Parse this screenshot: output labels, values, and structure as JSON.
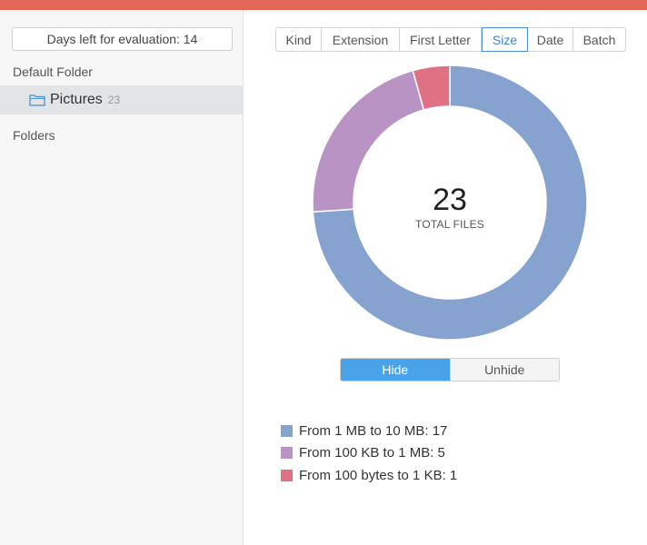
{
  "sidebar": {
    "evaluation_button": "Days left for evaluation: 14",
    "default_folder_title": "Default Folder",
    "selected_folder": {
      "label": "Pictures",
      "count": "23",
      "icon": "folder-icon"
    },
    "folders_title": "Folders"
  },
  "tabs": [
    {
      "label": "Kind",
      "active": false
    },
    {
      "label": "Extension",
      "active": false
    },
    {
      "label": "First Letter",
      "active": false
    },
    {
      "label": "Size",
      "active": true
    },
    {
      "label": "Date",
      "active": false
    },
    {
      "label": "Batch",
      "active": false
    }
  ],
  "chart": {
    "total": "23",
    "total_label": "TOTAL FILES",
    "segments": [
      {
        "label": "From 1 MB to 10 MB",
        "value": 17,
        "color": "#86a3d0"
      },
      {
        "label": "From 100 KB to 1 MB",
        "value": 5,
        "color": "#b893c4"
      },
      {
        "label": "From 100 bytes to 1 KB",
        "value": 1,
        "color": "#e07185"
      }
    ]
  },
  "toggle": {
    "hide": "Hide",
    "unhide": "Unhide"
  },
  "legend": [
    {
      "text": "From 1 MB to 10 MB: 17",
      "color": "#86a3d0"
    },
    {
      "text": "From 100 KB to 1 MB: 5",
      "color": "#b893c4"
    },
    {
      "text": "From 100 bytes to 1 KB: 1",
      "color": "#e07185"
    }
  ],
  "colors": {
    "title_bar": "#e36659",
    "accent": "#4aa3e8"
  }
}
